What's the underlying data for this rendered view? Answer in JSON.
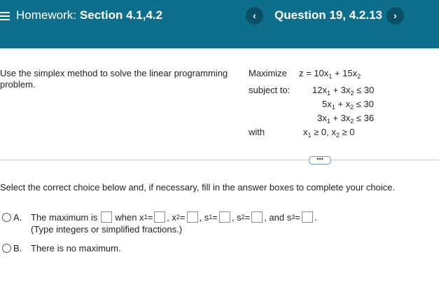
{
  "header": {
    "homework_prefix": "Homework:",
    "homework_title": "Section 4.1,4.2",
    "question_title": "Question 19, 4.2.13",
    "prev_glyph": "‹",
    "next_glyph": "›",
    "background_color": "#0e6e8c"
  },
  "problem": {
    "instruction": "Use the simplex method to solve the linear programming problem.",
    "maximize_label": "Maximize",
    "subject_label": "subject to:",
    "with_label": "with",
    "objective": {
      "a": "z = 10x",
      "s1": "1",
      "b": " + 15x",
      "s2": "2"
    },
    "constraints": [
      {
        "a": "12x",
        "s1": "1",
        "b": " + 3x",
        "s2": "2",
        "c": " ≤ 30"
      },
      {
        "a": "5x",
        "s1": "1",
        "b": " + x",
        "s2": "2",
        "c": " ≤ 30"
      },
      {
        "a": "3x",
        "s1": "1",
        "b": " + 3x",
        "s2": "2",
        "c": " ≤ 36"
      }
    ],
    "nonneg": {
      "a": "x",
      "s1": "1",
      "b": " ≥ 0, x",
      "s2": "2",
      "c": " ≥ 0"
    }
  },
  "more_button": "•••",
  "prompt": "Select the correct choice below and, if necessary, fill in the answer boxes to complete your choice.",
  "choices": {
    "a": {
      "letter": "A.",
      "t1": "The maximum is",
      "t2": "when x",
      "x1_sub": "1",
      "eq": " =",
      "t3": ", x",
      "x2_sub": "2",
      "t4": ", s",
      "s1_sub": "1",
      "t5": ", s",
      "s2_sub": "2",
      "t6": ", and s",
      "s3_sub": "3",
      "end": ".",
      "hint": "(Type integers or simplified fractions.)"
    },
    "b": {
      "letter": "B.",
      "text": "There is no maximum."
    }
  }
}
